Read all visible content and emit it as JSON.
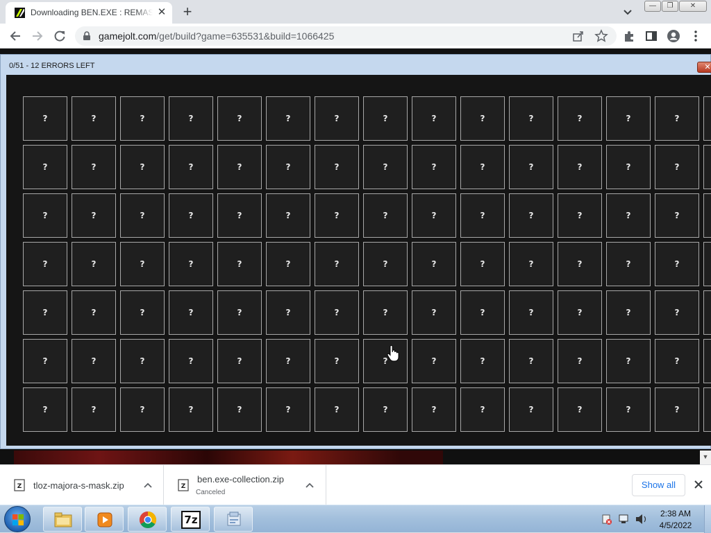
{
  "browser": {
    "tab": {
      "title": "Downloading BEN.EXE : REMASTERED",
      "close": "✕"
    },
    "new_tab": "+",
    "url": {
      "host": "gamejolt.com",
      "path": "/get/build?game=635531&build=1066425"
    }
  },
  "window_controls": {
    "minimize": "—",
    "maximize": "❐",
    "close": "✕"
  },
  "game": {
    "title": "0/51 - 12 ERRORS LEFT",
    "close": "✕",
    "tile_label": "?",
    "grid": {
      "rows": 7,
      "columns": 14
    }
  },
  "downloads": [
    {
      "name": "tloz-majora-s-mask.zip",
      "status": ""
    },
    {
      "name": "ben.exe-collection.zip",
      "status": "Canceled"
    }
  ],
  "show_all": "Show all",
  "taskbar": {
    "apps": [
      "file-explorer",
      "media-player",
      "chrome",
      "7zip",
      "installer"
    ],
    "seven_zip_label": "7z",
    "time": "2:38 AM",
    "date": "4/5/2022"
  },
  "colors": {
    "accent": "#1a73e8",
    "game_bg": "#151515",
    "tile_border": "#a8a8a8",
    "titlebar": "#c5d8ee"
  }
}
